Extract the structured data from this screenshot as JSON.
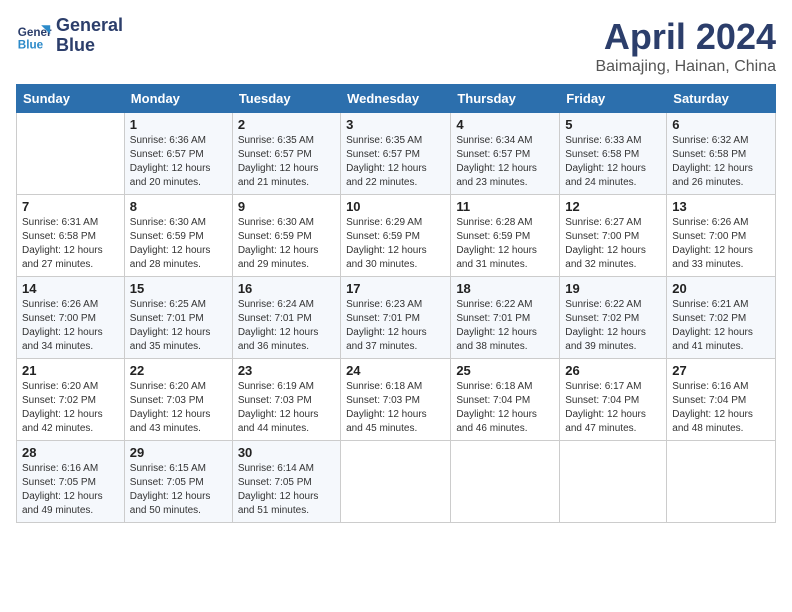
{
  "header": {
    "logo_line1": "General",
    "logo_line2": "Blue",
    "title": "April 2024",
    "subtitle": "Baimajing, Hainan, China"
  },
  "columns": [
    "Sunday",
    "Monday",
    "Tuesday",
    "Wednesday",
    "Thursday",
    "Friday",
    "Saturday"
  ],
  "weeks": [
    [
      {
        "num": "",
        "info": ""
      },
      {
        "num": "1",
        "info": "Sunrise: 6:36 AM\nSunset: 6:57 PM\nDaylight: 12 hours\nand 20 minutes."
      },
      {
        "num": "2",
        "info": "Sunrise: 6:35 AM\nSunset: 6:57 PM\nDaylight: 12 hours\nand 21 minutes."
      },
      {
        "num": "3",
        "info": "Sunrise: 6:35 AM\nSunset: 6:57 PM\nDaylight: 12 hours\nand 22 minutes."
      },
      {
        "num": "4",
        "info": "Sunrise: 6:34 AM\nSunset: 6:57 PM\nDaylight: 12 hours\nand 23 minutes."
      },
      {
        "num": "5",
        "info": "Sunrise: 6:33 AM\nSunset: 6:58 PM\nDaylight: 12 hours\nand 24 minutes."
      },
      {
        "num": "6",
        "info": "Sunrise: 6:32 AM\nSunset: 6:58 PM\nDaylight: 12 hours\nand 26 minutes."
      }
    ],
    [
      {
        "num": "7",
        "info": "Sunrise: 6:31 AM\nSunset: 6:58 PM\nDaylight: 12 hours\nand 27 minutes."
      },
      {
        "num": "8",
        "info": "Sunrise: 6:30 AM\nSunset: 6:59 PM\nDaylight: 12 hours\nand 28 minutes."
      },
      {
        "num": "9",
        "info": "Sunrise: 6:30 AM\nSunset: 6:59 PM\nDaylight: 12 hours\nand 29 minutes."
      },
      {
        "num": "10",
        "info": "Sunrise: 6:29 AM\nSunset: 6:59 PM\nDaylight: 12 hours\nand 30 minutes."
      },
      {
        "num": "11",
        "info": "Sunrise: 6:28 AM\nSunset: 6:59 PM\nDaylight: 12 hours\nand 31 minutes."
      },
      {
        "num": "12",
        "info": "Sunrise: 6:27 AM\nSunset: 7:00 PM\nDaylight: 12 hours\nand 32 minutes."
      },
      {
        "num": "13",
        "info": "Sunrise: 6:26 AM\nSunset: 7:00 PM\nDaylight: 12 hours\nand 33 minutes."
      }
    ],
    [
      {
        "num": "14",
        "info": "Sunrise: 6:26 AM\nSunset: 7:00 PM\nDaylight: 12 hours\nand 34 minutes."
      },
      {
        "num": "15",
        "info": "Sunrise: 6:25 AM\nSunset: 7:01 PM\nDaylight: 12 hours\nand 35 minutes."
      },
      {
        "num": "16",
        "info": "Sunrise: 6:24 AM\nSunset: 7:01 PM\nDaylight: 12 hours\nand 36 minutes."
      },
      {
        "num": "17",
        "info": "Sunrise: 6:23 AM\nSunset: 7:01 PM\nDaylight: 12 hours\nand 37 minutes."
      },
      {
        "num": "18",
        "info": "Sunrise: 6:22 AM\nSunset: 7:01 PM\nDaylight: 12 hours\nand 38 minutes."
      },
      {
        "num": "19",
        "info": "Sunrise: 6:22 AM\nSunset: 7:02 PM\nDaylight: 12 hours\nand 39 minutes."
      },
      {
        "num": "20",
        "info": "Sunrise: 6:21 AM\nSunset: 7:02 PM\nDaylight: 12 hours\nand 41 minutes."
      }
    ],
    [
      {
        "num": "21",
        "info": "Sunrise: 6:20 AM\nSunset: 7:02 PM\nDaylight: 12 hours\nand 42 minutes."
      },
      {
        "num": "22",
        "info": "Sunrise: 6:20 AM\nSunset: 7:03 PM\nDaylight: 12 hours\nand 43 minutes."
      },
      {
        "num": "23",
        "info": "Sunrise: 6:19 AM\nSunset: 7:03 PM\nDaylight: 12 hours\nand 44 minutes."
      },
      {
        "num": "24",
        "info": "Sunrise: 6:18 AM\nSunset: 7:03 PM\nDaylight: 12 hours\nand 45 minutes."
      },
      {
        "num": "25",
        "info": "Sunrise: 6:18 AM\nSunset: 7:04 PM\nDaylight: 12 hours\nand 46 minutes."
      },
      {
        "num": "26",
        "info": "Sunrise: 6:17 AM\nSunset: 7:04 PM\nDaylight: 12 hours\nand 47 minutes."
      },
      {
        "num": "27",
        "info": "Sunrise: 6:16 AM\nSunset: 7:04 PM\nDaylight: 12 hours\nand 48 minutes."
      }
    ],
    [
      {
        "num": "28",
        "info": "Sunrise: 6:16 AM\nSunset: 7:05 PM\nDaylight: 12 hours\nand 49 minutes."
      },
      {
        "num": "29",
        "info": "Sunrise: 6:15 AM\nSunset: 7:05 PM\nDaylight: 12 hours\nand 50 minutes."
      },
      {
        "num": "30",
        "info": "Sunrise: 6:14 AM\nSunset: 7:05 PM\nDaylight: 12 hours\nand 51 minutes."
      },
      {
        "num": "",
        "info": ""
      },
      {
        "num": "",
        "info": ""
      },
      {
        "num": "",
        "info": ""
      },
      {
        "num": "",
        "info": ""
      }
    ]
  ]
}
